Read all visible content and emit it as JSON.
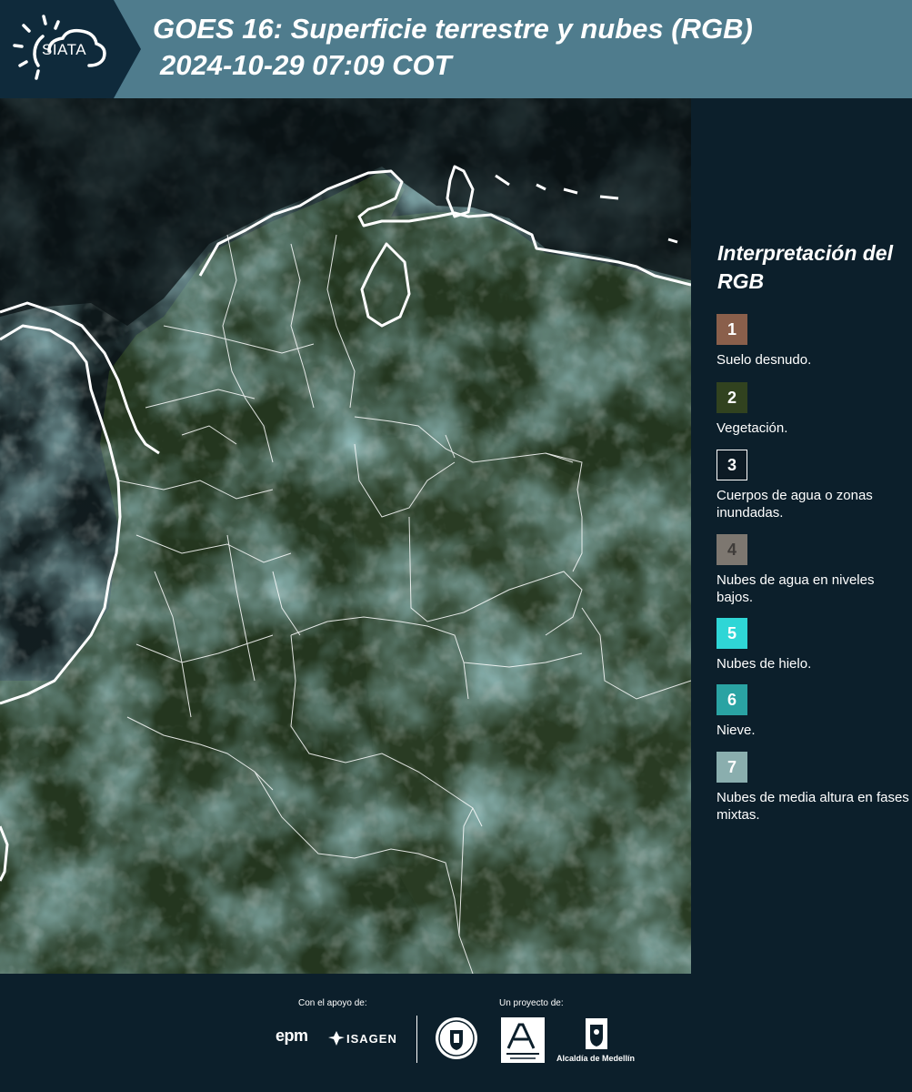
{
  "header": {
    "logo_text": "SIATA",
    "title_line1": "GOES 16: Superficie terrestre y nubes (RGB)",
    "title_line2": "2024-10-29 07:09 COT"
  },
  "legend": {
    "title": "Interpretación del RGB",
    "items": [
      {
        "number": "1",
        "label": "Suelo desnudo.",
        "color": "#8a5f4b"
      },
      {
        "number": "2",
        "label": "Vegetación.",
        "color": "#31421f"
      },
      {
        "number": "3",
        "label": "Cuerpos de agua o zonas inundadas.",
        "color": "#0d1a24"
      },
      {
        "number": "4",
        "label": "Nubes de agua en niveles bajos.",
        "color": "#7d7770"
      },
      {
        "number": "5",
        "label": "Nubes de hielo.",
        "color": "#2fd6d6"
      },
      {
        "number": "6",
        "label": "Nieve.",
        "color": "#2aa3a3"
      },
      {
        "number": "7",
        "label": "Nubes de media altura en fases mixtas.",
        "color": "#8aaeae"
      }
    ]
  },
  "footer": {
    "support_label": "Con el apoyo de:",
    "project_label": "Un proyecto de:",
    "sponsor_epm": "epm",
    "sponsor_isagen": "ISAGEN",
    "alcaldia": "Alcaldía de Medellín"
  },
  "colors": {
    "header_bg": "#4f7c8d",
    "logo_bg": "#0f2a3b",
    "panel_bg": "#0c1f2b"
  }
}
